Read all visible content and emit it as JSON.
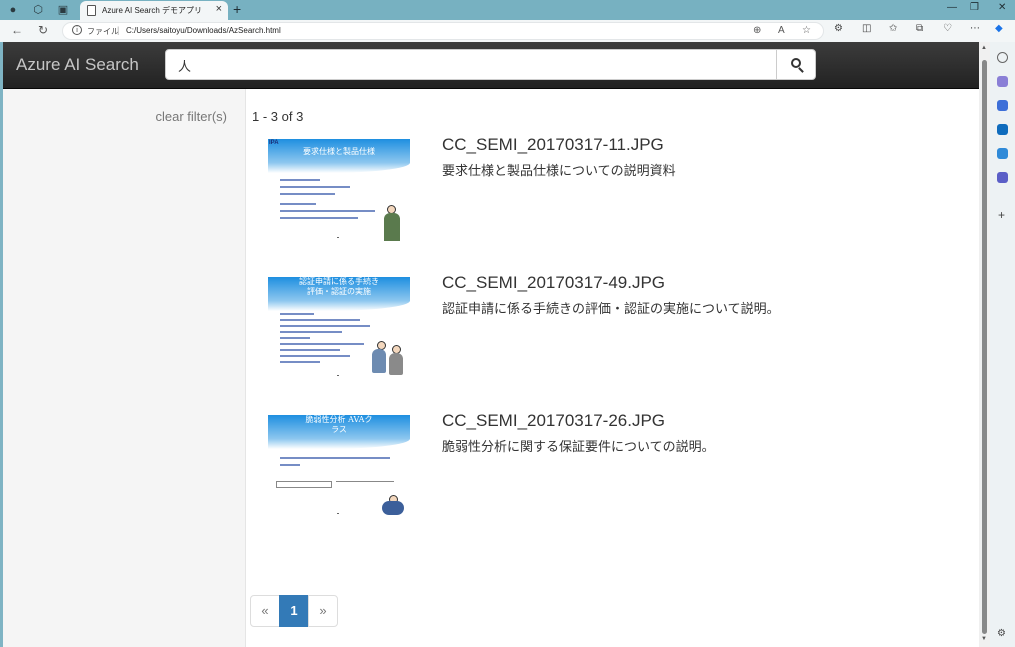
{
  "browser": {
    "tab_title": "Azure AI Search デモアプリ",
    "url_prefix": "ファイル",
    "url": "C:/Users/saitoyu/Downloads/AzSearch.html"
  },
  "app": {
    "brand": "Azure AI Search",
    "search_value": "人",
    "clear_filters": "clear filter(s)",
    "result_count": "1 - 3 of 3"
  },
  "results": [
    {
      "title": "CC_SEMI_20170317-11.JPG",
      "description": "要求仕様と製品仕様についての説明資料",
      "thumb_title": "要求仕様と製品仕様"
    },
    {
      "title": "CC_SEMI_20170317-49.JPG",
      "description": "認証申請に係る手続きの評価・認証の実施について説明。",
      "thumb_title": "認証申請に係る手続き 評価・認証の実施"
    },
    {
      "title": "CC_SEMI_20170317-26.JPG",
      "description": "脆弱性分析に関する保証要件についての説明。",
      "thumb_title": "脆弱性分析 AVAクラス"
    }
  ],
  "pager": {
    "prev": "«",
    "page": "1",
    "next": "»"
  },
  "colors": {
    "navbar": "#222222",
    "active_page": "#337ab7",
    "browser_frame": "#77b1c1"
  },
  "icons": [
    "search-icon",
    "back-icon",
    "refresh-icon",
    "info-icon",
    "zoom-icon",
    "read-aloud-icon",
    "favorite-icon",
    "extensions-icon",
    "copilot-icon"
  ]
}
